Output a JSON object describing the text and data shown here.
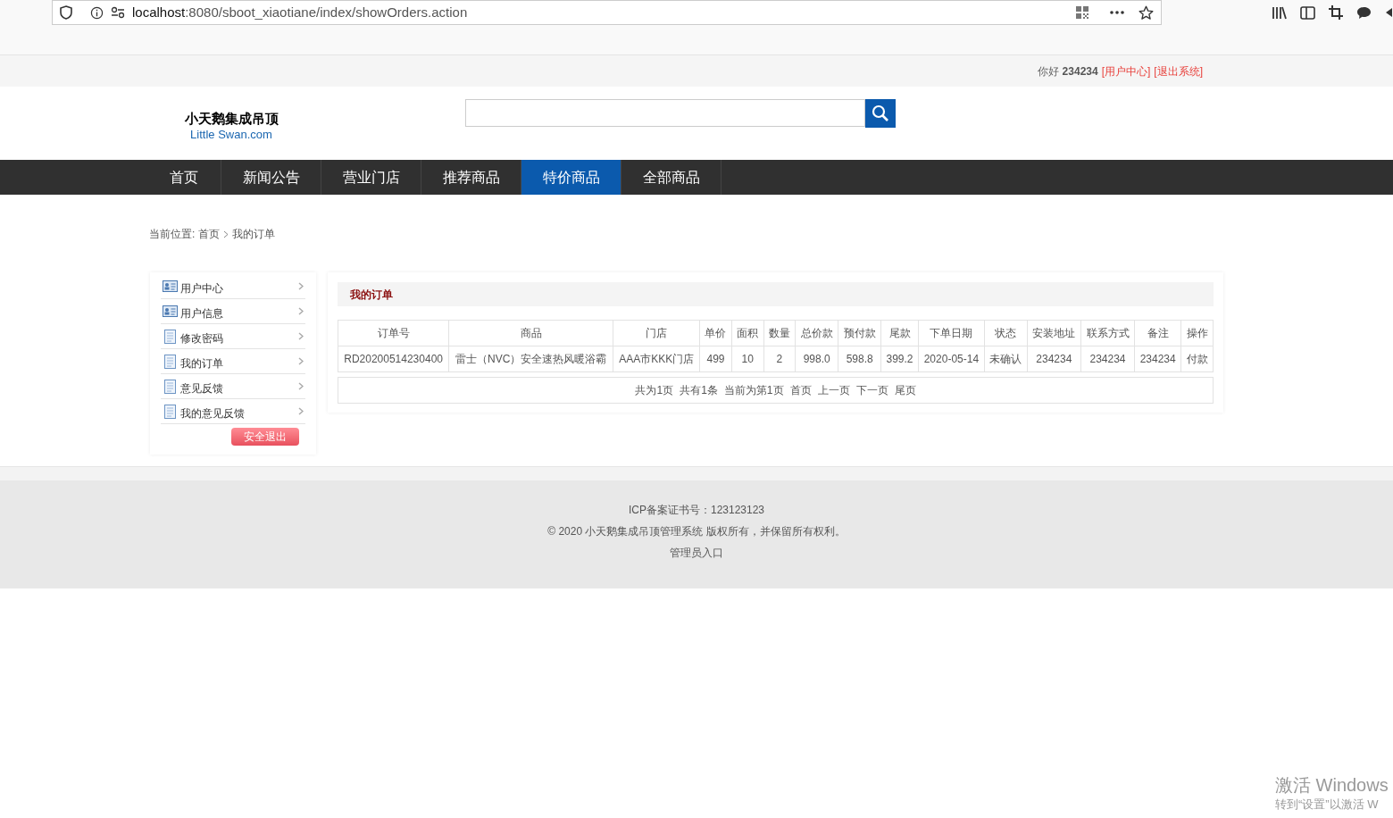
{
  "browser": {
    "url_host": "localhost",
    "url_rest": ":8080/sboot_xiaotiane/index/showOrders.action"
  },
  "top_bar": {
    "greeting": "你好",
    "username": "234234",
    "links": [
      "[用户中心]",
      "[退出系统]"
    ]
  },
  "logo": {
    "title": "小天鹅集成吊顶",
    "subtitle": "Little Swan.com"
  },
  "nav": [
    {
      "label": "首页",
      "selected": false
    },
    {
      "label": "新闻公告",
      "selected": false
    },
    {
      "label": "营业门店",
      "selected": false
    },
    {
      "label": "推荐商品",
      "selected": false
    },
    {
      "label": "特价商品",
      "selected": true
    },
    {
      "label": "全部商品",
      "selected": false
    }
  ],
  "breadcrumb": {
    "prefix": "当前位置:",
    "items": [
      "首页",
      "我的订单"
    ]
  },
  "sidebar": {
    "items": [
      {
        "label": "用户中心",
        "kind": "card"
      },
      {
        "label": "用户信息",
        "kind": "card"
      },
      {
        "label": "修改密码",
        "kind": "doc"
      },
      {
        "label": "我的订单",
        "kind": "doc"
      },
      {
        "label": "意见反馈",
        "kind": "doc"
      },
      {
        "label": "我的意见反馈",
        "kind": "doc"
      }
    ],
    "logout_button": "安全退出"
  },
  "orders": {
    "title": "我的订单",
    "columns": [
      "订单号",
      "商品",
      "门店",
      "单价",
      "面积",
      "数量",
      "总价款",
      "预付款",
      "尾款",
      "下单日期",
      "状态",
      "安装地址",
      "联系方式",
      "备注",
      "操作"
    ],
    "rows": [
      [
        "RD20200514230400",
        "雷士（NVC）安全速热风暖浴霸",
        "AAA市KKK门店",
        "499",
        "10",
        "2",
        "998.0",
        "598.8",
        "399.2",
        "2020-05-14",
        "未确认",
        "234234",
        "234234",
        "234234",
        "付款"
      ]
    ],
    "pagination": [
      "共为1页",
      "共有1条",
      "当前为第1页",
      "首页",
      "上一页",
      "下一页",
      "尾页"
    ]
  },
  "footer": [
    "ICP备案证书号：123123123",
    "© 2020 小天鹅集成吊顶管理系统 版权所有，并保留所有权利。",
    "管理员入口"
  ],
  "os_notice": [
    "激活 Windows",
    "转到“设置”以激活 W"
  ]
}
